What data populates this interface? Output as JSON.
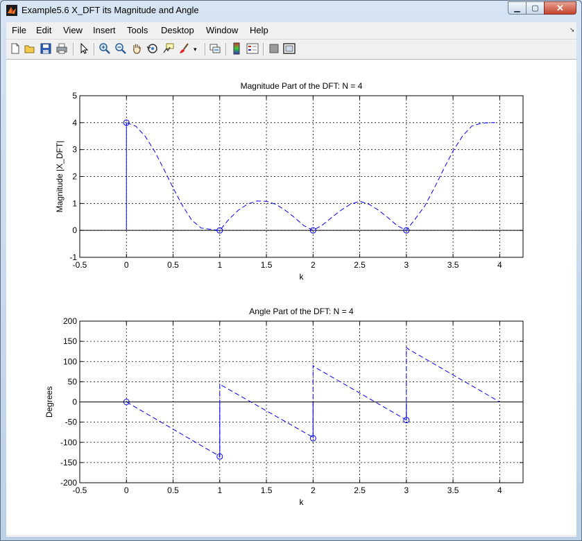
{
  "window": {
    "title": "Example5.6 X_DFT its Magnitude and Angle",
    "buttons": {
      "minimize": "▁",
      "maximize": "▢",
      "close": "✕"
    }
  },
  "menu": [
    "File",
    "Edit",
    "View",
    "Insert",
    "Tools",
    "Desktop",
    "Window",
    "Help"
  ],
  "toolbar": [
    "new-figure",
    "open-file",
    "save",
    "print",
    "edit-plot",
    "zoom-in",
    "zoom-out",
    "pan",
    "rotate-3d",
    "data-cursor",
    "brush",
    "link-plot",
    "colorbar",
    "legend",
    "hide-plot-tools",
    "show-plot-tools"
  ],
  "colors": {
    "series": "#0000ff",
    "axes": "#000000",
    "grid": "#000000"
  },
  "chart_data": [
    {
      "type": "line",
      "title": "Magnitude Part of the DFT: N = 4",
      "xlabel": "k",
      "ylabel": "Magnitude  |X_DFT|",
      "xlim": [
        -0.5,
        4.25
      ],
      "ylim": [
        -1,
        5
      ],
      "xticks": [
        -0.5,
        0,
        0.5,
        1,
        1.5,
        2,
        2.5,
        3,
        3.5,
        4
      ],
      "xtick_labels": [
        "-0.5",
        "0",
        "0.5",
        "1",
        "1.5",
        "2",
        "2.5",
        "3",
        "3.5",
        "4"
      ],
      "yticks": [
        -1,
        0,
        1,
        2,
        3,
        4,
        5
      ],
      "ytick_labels": [
        "-1",
        "0",
        "1",
        "2",
        "3",
        "4",
        "5"
      ],
      "grid": true,
      "stem": {
        "x": [
          0,
          1,
          2,
          3
        ],
        "y": [
          4,
          0,
          0,
          0
        ]
      },
      "curve": {
        "style": "dashed",
        "x": [
          0,
          0.1,
          0.2,
          0.3,
          0.4,
          0.5,
          0.6,
          0.7,
          0.8,
          0.9,
          1.0,
          1.1,
          1.2,
          1.3,
          1.4,
          1.5,
          1.6,
          1.7,
          1.8,
          1.9,
          2.0,
          2.1,
          2.2,
          2.3,
          2.4,
          2.5,
          2.6,
          2.7,
          2.8,
          2.9,
          3.0,
          3.1,
          3.2,
          3.3,
          3.4,
          3.5,
          3.6,
          3.7,
          3.8,
          3.9,
          3.95
        ],
        "y": [
          4.0,
          3.87,
          3.5,
          2.95,
          2.28,
          1.58,
          0.92,
          0.38,
          0.09,
          0.04,
          0.0,
          0.42,
          0.75,
          0.98,
          1.09,
          1.08,
          0.97,
          0.75,
          0.48,
          0.18,
          0.0,
          0.2,
          0.48,
          0.75,
          0.97,
          1.08,
          0.97,
          0.75,
          0.48,
          0.18,
          0.0,
          0.45,
          0.92,
          1.58,
          2.28,
          2.95,
          3.5,
          3.87,
          3.98,
          4.0,
          4.0
        ]
      }
    },
    {
      "type": "line",
      "title": "Angle Part of the DFT: N = 4",
      "xlabel": "k",
      "ylabel": "Degrees",
      "xlim": [
        -0.5,
        4.25
      ],
      "ylim": [
        -200,
        200
      ],
      "xticks": [
        -0.5,
        0,
        0.5,
        1,
        1.5,
        2,
        2.5,
        3,
        3.5,
        4
      ],
      "xtick_labels": [
        "-0.5",
        "0",
        "0.5",
        "1",
        "1.5",
        "2",
        "2.5",
        "3",
        "3.5",
        "4"
      ],
      "yticks": [
        -200,
        -150,
        -100,
        -50,
        0,
        50,
        100,
        150,
        200
      ],
      "ytick_labels": [
        "-200",
        "-150",
        "-100",
        "-50",
        "0",
        "50",
        "100",
        "150",
        "200"
      ],
      "grid": true,
      "stem": {
        "x": [
          0,
          1,
          2,
          3
        ],
        "y": [
          0,
          -135,
          -90,
          -45
        ]
      },
      "curve": {
        "style": "dashed",
        "x": [
          0,
          0.98,
          1.0,
          1.0,
          1.02,
          1.98,
          2.0,
          2.0,
          2.02,
          2.98,
          3.0,
          3.0,
          3.02,
          4.0
        ],
        "y": [
          0,
          -132,
          -135,
          45,
          41,
          -85,
          -90,
          90,
          86,
          -42,
          -45,
          135,
          131,
          0
        ]
      }
    }
  ]
}
